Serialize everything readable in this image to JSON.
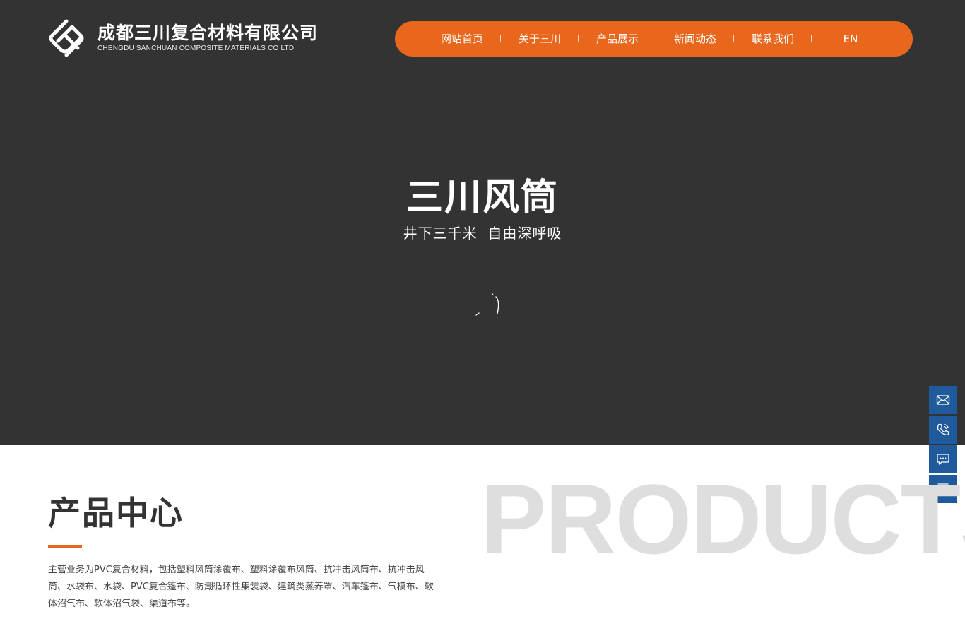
{
  "header": {
    "logo": {
      "name_cn": "成都三川复合材料有限公司",
      "name_en": "CHENGDU SANCHUAN COMPOSITE MATERIALS CO LTD"
    },
    "nav": [
      {
        "label": "网站首页"
      },
      {
        "label": "关于三川"
      },
      {
        "label": "产品展示"
      },
      {
        "label": "新闻动态"
      },
      {
        "label": "联系我们"
      },
      {
        "label": "EN"
      }
    ]
  },
  "hero": {
    "title": "三川风筒",
    "subtitle": "井下三千米  自由深呼吸"
  },
  "side_buttons": [
    {
      "icon": "mail-icon"
    },
    {
      "icon": "phone-icon"
    },
    {
      "icon": "chat-icon"
    },
    {
      "icon": "back-to-top-icon"
    }
  ],
  "products": {
    "bg_text": "PRODUCTS",
    "title": "产品中心",
    "description": "主营业务为PVC复合材料，包括塑料风筒涂覆布、塑料涂覆布风筒、抗冲击风筒布、抗冲击风筒、水袋布、水袋、PVC复合篷布、防潮循环性集装袋、建筑类蒸养罩、汽车篷布、气模布、软体沼气布、软体沼气袋、渠道布等。"
  },
  "colors": {
    "hero_bg": "#333334",
    "accent_orange": "#e8671d",
    "side_blue": "#1f5b9c",
    "bg_text_gray": "#dedede"
  }
}
